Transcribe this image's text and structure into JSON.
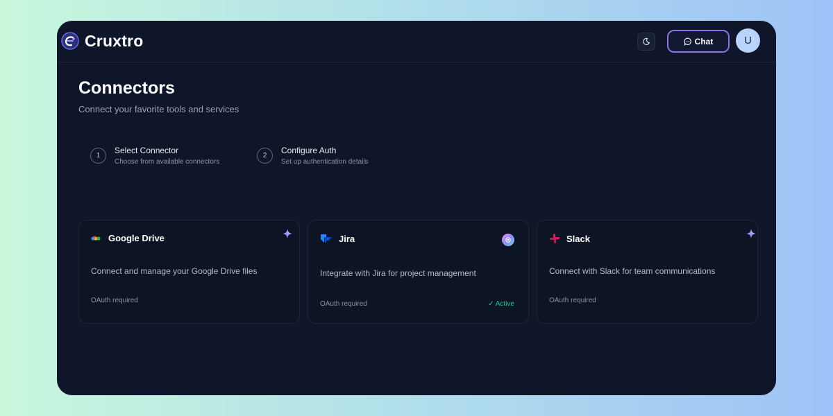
{
  "app": {
    "name": "Cruxtro",
    "chat_label": "Chat",
    "avatar_initial": "U",
    "icons": {
      "logo": "cruxtro-logo-icon",
      "theme": "moon-icon",
      "chat": "chat-bubble-icon"
    }
  },
  "page": {
    "title": "Connectors",
    "subtitle": "Connect your favorite tools and services"
  },
  "steps": [
    {
      "number": "1",
      "title": "Select Connector",
      "description": "Choose from available connectors"
    },
    {
      "number": "2",
      "title": "Configure Auth",
      "description": "Set up authentication details"
    }
  ],
  "connectors": [
    {
      "name": "Google Drive",
      "icon": "google-drive-icon",
      "description": "Connect and manage your Google Drive files",
      "requirement": "OAuth required",
      "status": "",
      "badge": "sparkle-icon"
    },
    {
      "name": "Jira",
      "icon": "jira-icon",
      "description": "Integrate with Jira for project management",
      "requirement": "OAuth required",
      "status": "✓ Active",
      "badge": "ai-assistant-icon"
    },
    {
      "name": "Slack",
      "icon": "slack-icon",
      "description": "Connect with Slack for team communications",
      "requirement": "OAuth required",
      "status": "",
      "badge": "sparkle-icon"
    }
  ],
  "colors": {
    "window_bg": "#0f1629",
    "card_bg": "#0d1424",
    "accent": "#8a72e6",
    "active_status": "#22c58b",
    "avatar_bg": "#b9d3fb"
  }
}
